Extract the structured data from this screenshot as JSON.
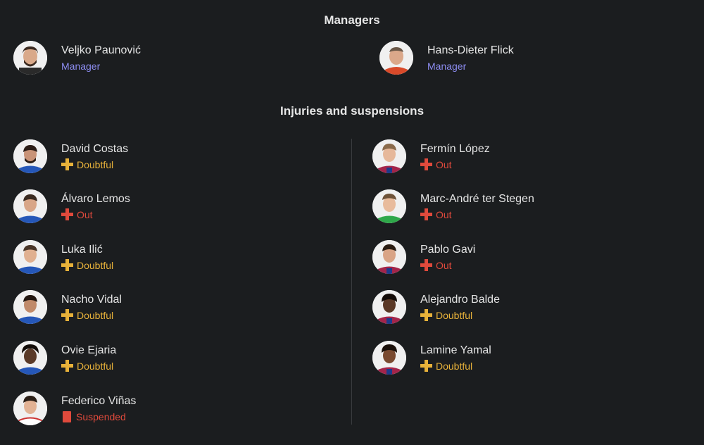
{
  "managers": {
    "title": "Managers",
    "items": [
      {
        "name": "Veljko Paunović",
        "role": "Manager"
      },
      {
        "name": "Hans-Dieter Flick",
        "role": "Manager"
      }
    ]
  },
  "injuries": {
    "title": "Injuries and suspensions",
    "left": [
      {
        "name": "David Costas",
        "status": "Doubtful"
      },
      {
        "name": "Álvaro Lemos",
        "status": "Out"
      },
      {
        "name": "Luka Ilić",
        "status": "Doubtful"
      },
      {
        "name": "Nacho Vidal",
        "status": "Doubtful"
      },
      {
        "name": "Ovie Ejaria",
        "status": "Doubtful"
      },
      {
        "name": "Federico Viñas",
        "status": "Suspended"
      }
    ],
    "right": [
      {
        "name": "Fermín López",
        "status": "Out"
      },
      {
        "name": "Marc-André ter Stegen",
        "status": "Out"
      },
      {
        "name": "Pablo Gavi",
        "status": "Out"
      },
      {
        "name": "Alejandro Balde",
        "status": "Doubtful"
      },
      {
        "name": "Lamine Yamal",
        "status": "Doubtful"
      }
    ]
  },
  "colors": {
    "background": "#1b1d1f",
    "manager_role": "#8c8cf0",
    "doubtful": "#e8b23a",
    "out": "#e04a3c",
    "suspended": "#e04a3c"
  },
  "icons": {
    "doubtful": "plus-cross-icon",
    "out": "plus-cross-icon",
    "suspended": "red-card-icon"
  }
}
